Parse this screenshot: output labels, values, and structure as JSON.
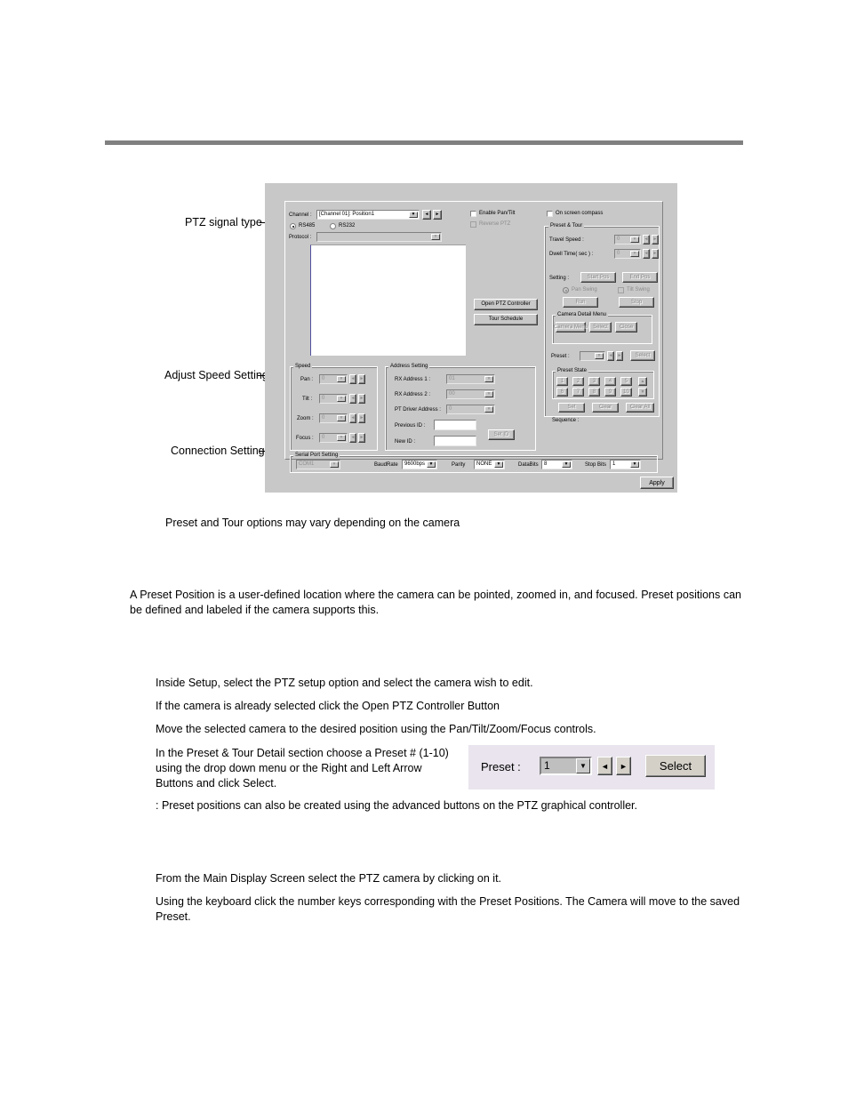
{
  "page": {
    "caption_note": "Preset and Tour options may vary depending on the camera",
    "intro_paragraph": "A Preset Position is a user-defined location where the camera can be pointed, zoomed in, and focused.  Preset positions can be defined and labeled if the camera supports this.",
    "steps": [
      "Inside Setup, select the PTZ setup option and select the camera wish to edit.",
      "If the camera is already selected click the Open PTZ Controller Button",
      "Move the selected camera to the desired position using the Pan/Tilt/Zoom/Focus controls.",
      "In the Preset & Tour Detail section choose a Preset # (1-10) using the drop down menu or the Right and Left Arrow Buttons and click Select."
    ],
    "note_line": ": Preset positions can also be created using the advanced buttons on the PTZ graphical controller.",
    "closing_lines": [
      "From the Main Display Screen select the PTZ camera by clicking on it.",
      "Using the keyboard click the number keys corresponding with the Preset Positions.  The Camera will move to the saved Preset."
    ]
  },
  "annotations": [
    {
      "label": "PTZ signal type"
    },
    {
      "label": "Adjust Speed Settings"
    },
    {
      "label": "Connection Settings"
    }
  ],
  "dialog": {
    "channel": {
      "label": "Channel :",
      "value": "[Channel 01]: Position1",
      "prev_arrow": "◄",
      "next_arrow": "►"
    },
    "signal_type": {
      "rs485_label": "RS485",
      "rs232_label": "RS232",
      "selected": "RS485"
    },
    "protocol": {
      "label": "Protocol :",
      "value": ""
    },
    "checkboxes": [
      {
        "label": "Enable Pan/Tilt",
        "checked": false,
        "disabled": false
      },
      {
        "label": "Reverse PTZ",
        "checked": false,
        "disabled": true
      },
      {
        "label": "On screen compass",
        "checked": false,
        "disabled": false
      }
    ],
    "main_buttons": [
      {
        "label": "Open PTZ Controller"
      },
      {
        "label": "Tour Schedule"
      }
    ],
    "preset_tour": {
      "group_title": "Preset & Tour",
      "travel_speed": {
        "label": "Travel Speed :",
        "value": "0"
      },
      "dwell_time": {
        "label": "Dwell Time( sec ) :",
        "value": "0"
      },
      "setting_label": "Setting  :",
      "start_pos": "Start Pos",
      "end_pos": "End Pos",
      "pan_swing": "Pan Swing",
      "tilt_swing": "Tilt Swing",
      "run": "Run",
      "stop": "Stop",
      "camera_detail_menu": {
        "group_title": "Camera Detail Menu",
        "buttons": [
          "Camera Menu",
          "Select",
          "Close"
        ]
      },
      "preset": {
        "label": "Preset :",
        "value": "",
        "select": "Select"
      },
      "preset_state": {
        "group_title": "Preset State",
        "numbers": [
          "1",
          "2",
          "3",
          "4",
          "5",
          "6",
          "7",
          "8",
          "9",
          "10"
        ],
        "scroll_up": "▲",
        "scroll_down": "▼",
        "buttons": [
          "Set",
          "Clear",
          "Clear All"
        ],
        "sequence_label": "Sequence :"
      }
    },
    "speed": {
      "group_title": "Speed",
      "rows": [
        {
          "label": "Pan :",
          "value": "0"
        },
        {
          "label": "Tilt :",
          "value": "0"
        },
        {
          "label": "Zoom :",
          "value": "0"
        },
        {
          "label": "Focus :",
          "value": "0"
        }
      ]
    },
    "address_setting": {
      "group_title": "Address Setting",
      "rx_address_1": {
        "label": "RX Address 1 :",
        "value": "01"
      },
      "rx_address_2": {
        "label": "RX Address 2 :",
        "value": "00"
      },
      "pt_driver_address": {
        "label": "PT Driver Address  :",
        "value": "0"
      },
      "previous_id": {
        "label": "Previous ID :",
        "value": ""
      },
      "new_id": {
        "label": "New ID :",
        "value": ""
      },
      "set_id_button": "Set ID"
    },
    "serial_port": {
      "group_title": "Serial Port Setting",
      "com_port": {
        "value": "COM1"
      },
      "baud_rate": {
        "label": "BaudRate",
        "value": "9600bps"
      },
      "parity": {
        "label": "Parity",
        "value": "NONE"
      },
      "data_bits": {
        "label": "DataBits",
        "value": "8"
      },
      "stop_bits": {
        "label": "Stop Bits",
        "value": "1"
      }
    },
    "apply_button": "Apply"
  },
  "preset_inset": {
    "label": "Preset :",
    "value": "1",
    "drop_arrow": "▼",
    "left_arrow": "◄",
    "right_arrow": "►",
    "select_button": "Select"
  },
  "colors": {
    "dialog_bg": "#c8c8c8",
    "rule": "#808080",
    "inset_bg": "#e9e4ed"
  }
}
